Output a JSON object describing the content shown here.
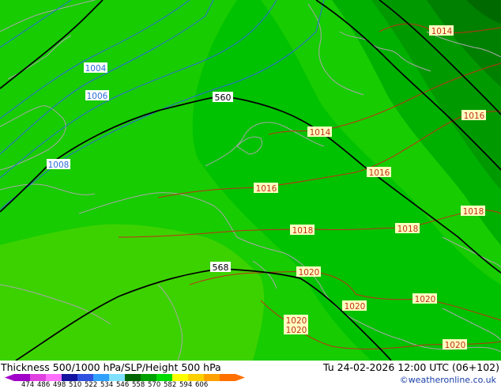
{
  "footer": {
    "title": "Thickness 500/1000 hPa/SLP/Height 500 hPa",
    "valid_time": "Tu 24-02-2026 12:00 UTC (06+102)",
    "credit": "©weatheronline.co.uk"
  },
  "legend": {
    "ticks": [
      "474",
      "486",
      "498",
      "510",
      "522",
      "534",
      "546",
      "558",
      "570",
      "582",
      "594",
      "606"
    ],
    "colors": [
      "#a000c8",
      "#e040e0",
      "#ff70ff",
      "#1414a0",
      "#3050e0",
      "#30a0ff",
      "#80e0ff",
      "#006400",
      "#00a000",
      "#00dc00",
      "#ffff00",
      "#ffd000",
      "#ffa000",
      "#ff7000"
    ]
  },
  "height_labels": [
    "560",
    "568"
  ],
  "isobar_labels_blue": [
    "1004",
    "1006",
    "1008"
  ],
  "isobar_labels_red": [
    "1014",
    "1014",
    "1016",
    "1016",
    "1016",
    "1018",
    "1018",
    "1018",
    "1020",
    "1020",
    "1020",
    "1020",
    "1020",
    "1020"
  ],
  "fill_colors": {
    "band_558_light": "#3cd200",
    "band_558": "#17cc00",
    "band_552": "#00c200",
    "band_546": "#00b000",
    "band_540": "#009a00",
    "band_534": "#008000",
    "band_528": "#006a00",
    "coast": "#a8a8a8",
    "blue_isobar": "#2c6cd8",
    "red_isobar": "#c03018",
    "height_contour": "#000000"
  }
}
